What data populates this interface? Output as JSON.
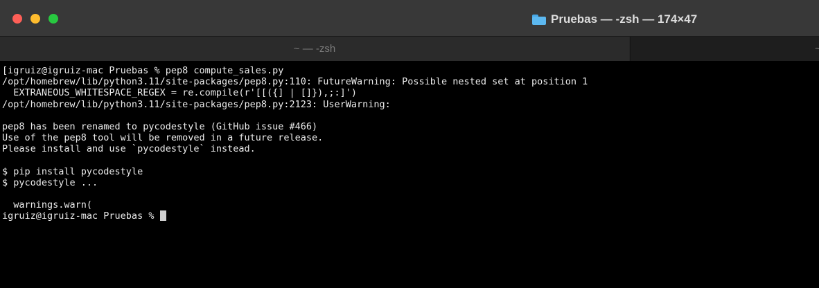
{
  "window": {
    "title": "Pruebas — -zsh — 174×47",
    "title_icon": "folder-icon",
    "colors": {
      "titlebar": "#383838",
      "terminal_bg": "#000000",
      "text": "#ececec",
      "close": "#fe5f57",
      "minimize": "#febc2e",
      "maximize": "#28c840"
    }
  },
  "tabs": [
    {
      "label": "~ — -zsh",
      "active": true
    },
    {
      "label": "~/",
      "active": false
    }
  ],
  "terminal": {
    "lines": [
      "[igruiz@igruiz-mac Pruebas % pep8 compute_sales.py",
      "/opt/homebrew/lib/python3.11/site-packages/pep8.py:110: FutureWarning: Possible nested set at position 1",
      "  EXTRANEOUS_WHITESPACE_REGEX = re.compile(r'[[({] | []}),;:]')",
      "/opt/homebrew/lib/python3.11/site-packages/pep8.py:2123: UserWarning:",
      "",
      "pep8 has been renamed to pycodestyle (GitHub issue #466)",
      "Use of the pep8 tool will be removed in a future release.",
      "Please install and use `pycodestyle` instead.",
      "",
      "$ pip install pycodestyle",
      "$ pycodestyle ...",
      "",
      "  warnings.warn("
    ],
    "prompt": "igruiz@igruiz-mac Pruebas % "
  }
}
